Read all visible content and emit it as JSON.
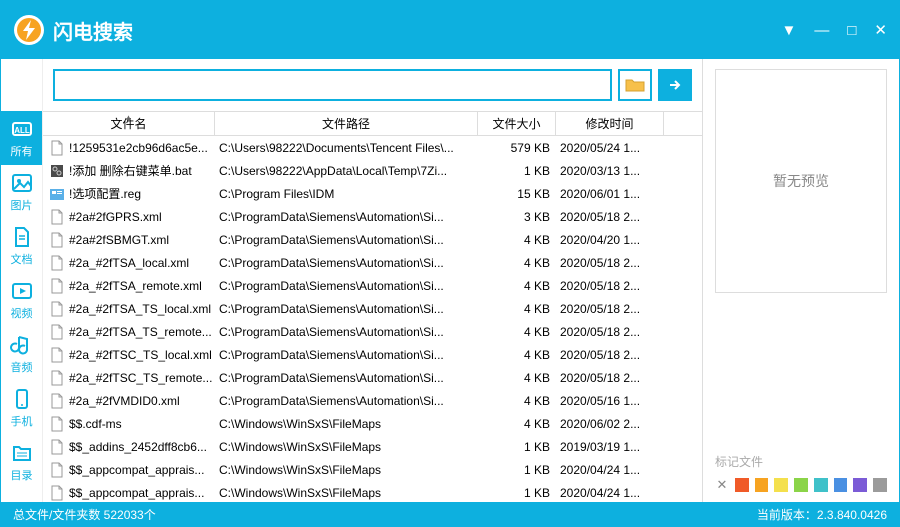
{
  "app": {
    "title": "闪电搜索"
  },
  "window_controls": {
    "dropdown": "▼",
    "minimize": "—",
    "maximize": "□",
    "close": "✕"
  },
  "sidebar": [
    {
      "id": "all",
      "label": "所有",
      "active": true
    },
    {
      "id": "image",
      "label": "图片",
      "active": false
    },
    {
      "id": "doc",
      "label": "文档",
      "active": false
    },
    {
      "id": "video",
      "label": "视频",
      "active": false
    },
    {
      "id": "audio",
      "label": "音频",
      "active": false
    },
    {
      "id": "phone",
      "label": "手机",
      "active": false
    },
    {
      "id": "dir",
      "label": "目录",
      "active": false
    }
  ],
  "search": {
    "value": "",
    "placeholder": ""
  },
  "columns": {
    "name": "文件名",
    "path": "文件路径",
    "size": "文件大小",
    "date": "修改时间"
  },
  "rows": [
    {
      "icon": "txt",
      "name": "!1259531e2cb96d6ac5e...",
      "path": "C:\\Users\\98222\\Documents\\Tencent Files\\...",
      "size": "579 KB",
      "date": "2020/05/24 1..."
    },
    {
      "icon": "bat",
      "name": "!添加 删除右键菜单.bat",
      "path": "C:\\Users\\98222\\AppData\\Local\\Temp\\7Zi...",
      "size": "1 KB",
      "date": "2020/03/13 1..."
    },
    {
      "icon": "reg",
      "name": "!选项配置.reg",
      "path": "C:\\Program Files\\IDM",
      "size": "15 KB",
      "date": "2020/06/01 1..."
    },
    {
      "icon": "xml",
      "name": "#2a#2fGPRS.xml",
      "path": "C:\\ProgramData\\Siemens\\Automation\\Si...",
      "size": "3 KB",
      "date": "2020/05/18 2..."
    },
    {
      "icon": "xml",
      "name": "#2a#2fSBMGT.xml",
      "path": "C:\\ProgramData\\Siemens\\Automation\\Si...",
      "size": "4 KB",
      "date": "2020/04/20 1..."
    },
    {
      "icon": "xml",
      "name": "#2a_#2fTSA_local.xml",
      "path": "C:\\ProgramData\\Siemens\\Automation\\Si...",
      "size": "4 KB",
      "date": "2020/05/18 2..."
    },
    {
      "icon": "xml",
      "name": "#2a_#2fTSA_remote.xml",
      "path": "C:\\ProgramData\\Siemens\\Automation\\Si...",
      "size": "4 KB",
      "date": "2020/05/18 2..."
    },
    {
      "icon": "xml",
      "name": "#2a_#2fTSA_TS_local.xml",
      "path": "C:\\ProgramData\\Siemens\\Automation\\Si...",
      "size": "4 KB",
      "date": "2020/05/18 2..."
    },
    {
      "icon": "xml",
      "name": "#2a_#2fTSA_TS_remote...",
      "path": "C:\\ProgramData\\Siemens\\Automation\\Si...",
      "size": "4 KB",
      "date": "2020/05/18 2..."
    },
    {
      "icon": "xml",
      "name": "#2a_#2fTSC_TS_local.xml",
      "path": "C:\\ProgramData\\Siemens\\Automation\\Si...",
      "size": "4 KB",
      "date": "2020/05/18 2..."
    },
    {
      "icon": "xml",
      "name": "#2a_#2fTSC_TS_remote...",
      "path": "C:\\ProgramData\\Siemens\\Automation\\Si...",
      "size": "4 KB",
      "date": "2020/05/18 2..."
    },
    {
      "icon": "xml",
      "name": "#2a_#2fVMDID0.xml",
      "path": "C:\\ProgramData\\Siemens\\Automation\\Si...",
      "size": "4 KB",
      "date": "2020/05/16 1..."
    },
    {
      "icon": "file",
      "name": "$$.cdf-ms",
      "path": "C:\\Windows\\WinSxS\\FileMaps",
      "size": "4 KB",
      "date": "2020/06/02 2..."
    },
    {
      "icon": "file",
      "name": "$$_addins_2452dff8cb6...",
      "path": "C:\\Windows\\WinSxS\\FileMaps",
      "size": "1 KB",
      "date": "2019/03/19 1..."
    },
    {
      "icon": "file",
      "name": "$$_appcompat_apprais...",
      "path": "C:\\Windows\\WinSxS\\FileMaps",
      "size": "1 KB",
      "date": "2020/04/24 1..."
    },
    {
      "icon": "file",
      "name": "$$_appcompat_apprais...",
      "path": "C:\\Windows\\WinSxS\\FileMaps",
      "size": "1 KB",
      "date": "2020/04/24 1..."
    }
  ],
  "preview": {
    "empty_text": "暂无预览",
    "tag_label": "标记文件"
  },
  "tag_colors": [
    "#f05a28",
    "#f7a321",
    "#f4e04d",
    "#8bd448",
    "#3fc1c9",
    "#4a90e2",
    "#7b5bd6",
    "#9b9b9b"
  ],
  "status": {
    "left": "总文件/文件夹数 522033个",
    "right": "当前版本：2.3.840.0426"
  }
}
